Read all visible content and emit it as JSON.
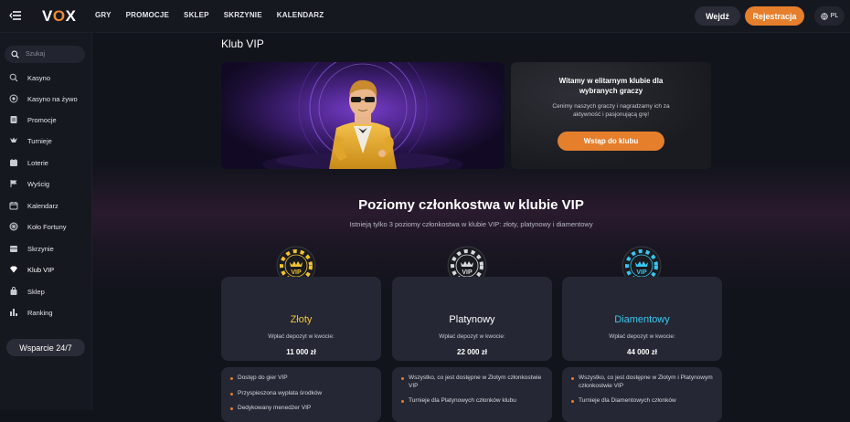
{
  "header": {
    "logo": [
      "V",
      "O",
      "X"
    ],
    "nav": [
      "GRY",
      "PROMOCJE",
      "SKLEP",
      "SKRZYNIE",
      "KALENDARZ"
    ],
    "login_label": "Wejdź",
    "register_label": "Rejestracja",
    "language": "PL"
  },
  "sidebar": {
    "search_placeholder": "Szukaj",
    "items": [
      {
        "label": "Kasyno",
        "icon": "casino-chip-icon"
      },
      {
        "label": "Kasyno na żywo",
        "icon": "live-casino-icon"
      },
      {
        "label": "Promocje",
        "icon": "promotions-icon"
      },
      {
        "label": "Turnieje",
        "icon": "trophy-icon"
      },
      {
        "label": "Loterie",
        "icon": "lottery-ticket-icon"
      },
      {
        "label": "Wyścig",
        "icon": "race-flag-icon"
      },
      {
        "label": "Kalendarz",
        "icon": "calendar-icon"
      },
      {
        "label": "Koło Fortuny",
        "icon": "fortune-wheel-icon"
      },
      {
        "label": "Skrzynie",
        "icon": "chest-icon"
      },
      {
        "label": "Klub VIP",
        "icon": "diamond-icon"
      },
      {
        "label": "Sklep",
        "icon": "shop-bag-icon"
      },
      {
        "label": "Ranking",
        "icon": "ranking-bars-icon"
      }
    ],
    "support_label": "Wsparcie 24/7"
  },
  "main": {
    "page_title": "Klub VIP",
    "promo": {
      "title": "Witamy w elitarnym klubie dla wybranych graczy",
      "text": "Cenimy naszych graczy i nagradzamy ich za aktywność i pasjonującą grę!",
      "button": "Wstąp do klubu"
    },
    "levels_title": "Poziomy członkostwa w klubie VIP",
    "levels_subtitle": "Istnieją tylko 3 poziomy członkostwa w klubie VIP: złoty, platynowy i diamentowy",
    "levels": [
      {
        "name": "Złoty",
        "color": "#f2c230",
        "chip_color": "#f2c230",
        "chip_text": "VIP",
        "deposit_label": "Wpłać depozyt w kwocie:",
        "deposit_value": "11 000 zł",
        "benefits": [
          "Dostęp do gier VIP",
          "Przyspieszona wypłata środków",
          "Dedykowany menedżer VIP"
        ]
      },
      {
        "name": "Platynowy",
        "color": "#ffffff",
        "chip_color": "#d8dae0",
        "chip_text": "VIP",
        "deposit_label": "Wpłać depozyt w kwocie:",
        "deposit_value": "22 000 zł",
        "benefits": [
          "Wszystko, co jest dostępne w Złotym członkostwie VIP",
          "Turnieje dla Platynowych członków klubu"
        ]
      },
      {
        "name": "Diamentowy",
        "color": "#39c6f0",
        "chip_color": "#39c6f0",
        "chip_text": "VIP",
        "deposit_label": "Wpłać depozyt w kwocie:",
        "deposit_value": "44 000 zł",
        "benefits": [
          "Wszystko, co jest dostępne w Złotym i Platynowym członkostwie VIP",
          "Turnieje dla Diamentowych członków"
        ]
      }
    ]
  }
}
